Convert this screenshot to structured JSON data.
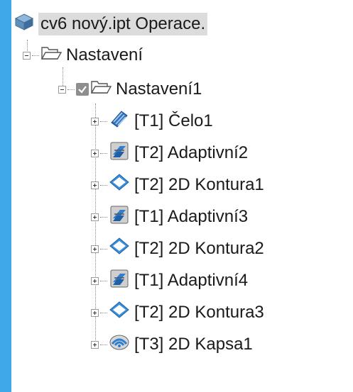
{
  "tree": {
    "root": {
      "label": "cv6 nový.ipt Operace.",
      "icon": "part-document-icon"
    },
    "setup": {
      "label": "Nastavení",
      "icon": "folder-open-icon"
    },
    "setup1": {
      "label": "Nastavení1",
      "icon": "folder-open-icon",
      "checked": true
    },
    "operations": [
      {
        "label": "[T1] Čelo1",
        "icon": "facing-operation-icon"
      },
      {
        "label": "[T2] Adaptivní2",
        "icon": "adaptive-operation-icon"
      },
      {
        "label": "[T2] 2D Kontura1",
        "icon": "contour-2d-operation-icon"
      },
      {
        "label": "[T1] Adaptivní3",
        "icon": "adaptive-operation-icon"
      },
      {
        "label": "[T2] 2D Kontura2",
        "icon": "contour-2d-operation-icon"
      },
      {
        "label": "[T1] Adaptivní4",
        "icon": "adaptive-operation-icon"
      },
      {
        "label": "[T2] 2D Kontura3",
        "icon": "contour-2d-operation-icon"
      },
      {
        "label": "[T3] 2D Kapsa1",
        "icon": "pocket-2d-operation-icon"
      }
    ]
  },
  "colors": {
    "background": "#3ea9e6",
    "selection": "#dcdcdc",
    "icon_blue": "#2f7fd0"
  }
}
